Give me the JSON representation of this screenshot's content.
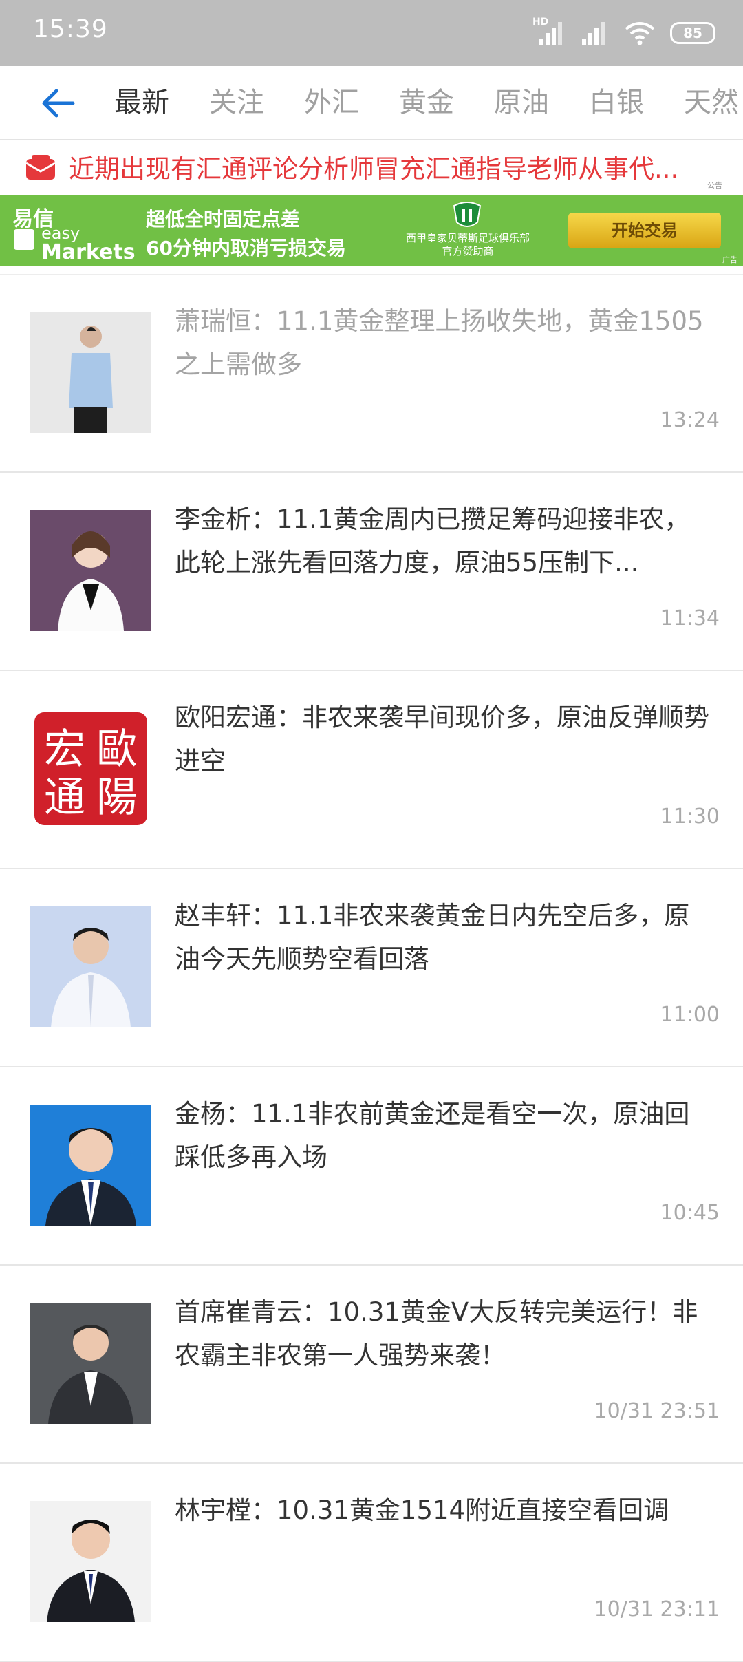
{
  "status_bar": {
    "time": "15:39",
    "battery": "85",
    "network": "HD"
  },
  "nav": {
    "tabs": [
      {
        "label": "最新"
      },
      {
        "label": "关注"
      },
      {
        "label": "外汇"
      },
      {
        "label": "黄金"
      },
      {
        "label": "原油"
      },
      {
        "label": "白银"
      },
      {
        "label": "天然"
      }
    ]
  },
  "notice": {
    "text": "近期出现有汇通评论分析师冒充汇通指导老师从事代...",
    "tag": "公告"
  },
  "ad": {
    "logo_cn": "易信",
    "logo_en1": "easy",
    "logo_en2": "Markets",
    "line1": "超低全时固定点差",
    "line2": "60分钟内取消亏损交易",
    "club_line1": "西甲皇家贝蒂斯足球俱乐部",
    "club_line2": "官方赞助商",
    "cta": "开始交易",
    "tag": "广告"
  },
  "feed": [
    {
      "title": "萧瑞恒：11.1黄金整理上扬收失地，黄金1505之上需做多",
      "time": "13:24",
      "read": true
    },
    {
      "title": "李金析：11.1黄金周内已攒足筹码迎接非农，此轮上涨先看回落力度，原油55压制下...",
      "time": "11:34",
      "read": false
    },
    {
      "title": "欧阳宏通：非农来袭早间现价多，原油反弹顺势进空",
      "time": "11:30",
      "read": false,
      "seal_text": [
        "宏",
        "歐",
        "通",
        "陽"
      ]
    },
    {
      "title": "赵丰轩：11.1非农来袭黄金日内先空后多，原油今天先顺势空看回落",
      "time": "11:00",
      "read": false
    },
    {
      "title": "金杨：11.1非农前黄金还是看空一次，原油回踩低多再入场",
      "time": "10:45",
      "read": false
    },
    {
      "title": "首席崔青云：10.31黄金V大反转完美运行！非农霸主非农第一人强势来袭！",
      "time": "10/31 23:51",
      "read": false
    },
    {
      "title": "林宇樘：10.31黄金1514附近直接空看回调",
      "time": "10/31 23:11",
      "read": false
    }
  ],
  "colors": {
    "accent_blue": "#1a73d6",
    "notice_red": "#e5383b",
    "ad_green": "#71c045",
    "status_bar_bg": "#bdbdbd"
  }
}
